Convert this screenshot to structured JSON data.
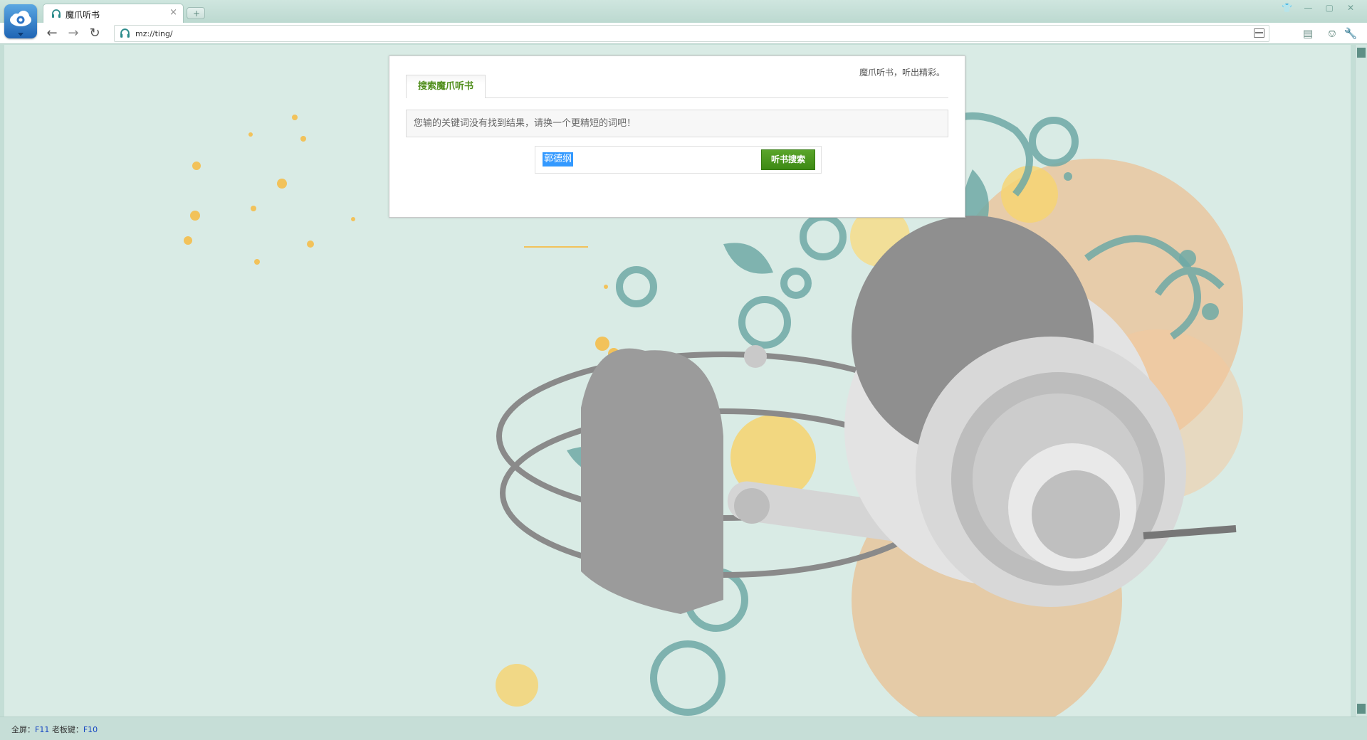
{
  "browser": {
    "tab": {
      "title": "魔爪听书",
      "close": "×"
    },
    "new_tab": "+",
    "address": "mz://ting/",
    "colors": {
      "frame": "#c4ded6",
      "accent_green": "#4f8d1a"
    }
  },
  "page": {
    "slogan": "魔爪听书，听出精彩。",
    "search_tab_label": "搜索魔爪听书",
    "notice": "您输的关键词没有找到结果，请换一个更精短的词吧！",
    "query": "郭德纲",
    "search_button": "听书搜索"
  },
  "status": {
    "fullscreen_label": "全屏：",
    "fullscreen_key": "F11",
    "boss_label": " 老板键：",
    "boss_key": "F10"
  },
  "icons": [
    "app-logo-icon",
    "headphone-tab-icon",
    "back-icon",
    "forward-icon",
    "reload-icon",
    "reader-mode-icon",
    "image-icon",
    "headphone-icon",
    "wrench-icon",
    "shirt-icon",
    "minimize-icon",
    "maximize-icon",
    "close-icon"
  ]
}
